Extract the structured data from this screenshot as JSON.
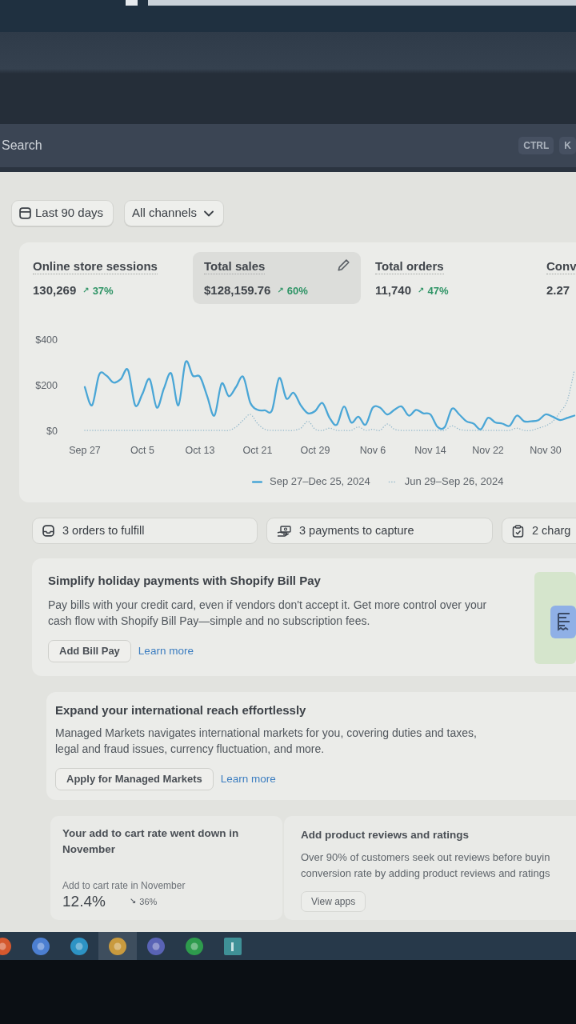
{
  "browser": {
    "search": {
      "placeholder": "Search",
      "shortcut_keys": [
        "CTRL",
        "K"
      ]
    }
  },
  "filters": [
    {
      "kind": "date",
      "label": "Last 90 days"
    },
    {
      "kind": "dropdown",
      "label": "All channels"
    }
  ],
  "metrics": [
    {
      "label": "Online store sessions",
      "value": "130,269",
      "arrow": "↗",
      "change": "37%",
      "selected": false
    },
    {
      "label": "Total sales",
      "value": "$128,159.76",
      "arrow": "↗",
      "change": "60%",
      "selected": true
    },
    {
      "label": "Total orders",
      "value": "11,740",
      "arrow": "↗",
      "change": "47%",
      "selected": false
    },
    {
      "label": "Conv",
      "value": "2.27",
      "selected": false
    }
  ],
  "chart_data": {
    "type": "line",
    "legend": "bottom",
    "categories": [
      "Sep 27",
      null,
      null,
      null,
      null,
      null,
      null,
      null,
      "Oct 5",
      null,
      null,
      null,
      null,
      null,
      null,
      null,
      "Oct 13",
      null,
      null,
      null,
      null,
      null,
      null,
      null,
      "Oct 21",
      null,
      null,
      null,
      null,
      null,
      null,
      null,
      "Oct 29",
      null,
      null,
      null,
      null,
      null,
      null,
      null,
      "Nov 6",
      null,
      null,
      null,
      null,
      null,
      null,
      null,
      "Nov 14",
      null,
      null,
      null,
      null,
      null,
      null,
      null,
      "Nov 22",
      null,
      null,
      null,
      null,
      null,
      null,
      null,
      "Nov 30",
      null,
      null,
      null,
      null
    ],
    "ylim": [
      0,
      400
    ],
    "yticks": [
      {
        "value": 0,
        "label": "$0"
      },
      {
        "value": 200,
        "label": "$200"
      },
      {
        "value": 400,
        "label": "$400"
      }
    ],
    "series": [
      {
        "name": "Sep 27–Dec 25, 2024",
        "color": "#4aa6d6",
        "line_style": "solid",
        "values": [
          190,
          110,
          245,
          240,
          210,
          225,
          265,
          110,
          160,
          225,
          100,
          185,
          250,
          110,
          300,
          240,
          235,
          150,
          65,
          205,
          150,
          190,
          235,
          120,
          90,
          88,
          88,
          230,
          140,
          165,
          110,
          75,
          85,
          120,
          55,
          25,
          105,
          35,
          60,
          25,
          100,
          100,
          70,
          90,
          105,
          65,
          90,
          75,
          70,
          15,
          15,
          95,
          70,
          40,
          30,
          5,
          55,
          35,
          30,
          20,
          65,
          40,
          40,
          45,
          70,
          60,
          45,
          55,
          65
        ]
      },
      {
        "name": "Jun 29–Sep 26, 2024",
        "color": "#93b8cb",
        "line_style": "dotted",
        "values": [
          0,
          0,
          0,
          0,
          0,
          0,
          0,
          0,
          0,
          0,
          0,
          0,
          0,
          0,
          0,
          0,
          0,
          0,
          0,
          0,
          0,
          15,
          45,
          70,
          30,
          5,
          0,
          0,
          0,
          0,
          10,
          40,
          5,
          0,
          10,
          0,
          0,
          0,
          15,
          0,
          5,
          0,
          28,
          5,
          0,
          0,
          0,
          0,
          0,
          0,
          0,
          20,
          5,
          0,
          0,
          0,
          0,
          0,
          0,
          0,
          10,
          0,
          0,
          10,
          20,
          40,
          80,
          130,
          265
        ]
      }
    ]
  },
  "tasks": [
    {
      "kind": "orders",
      "label": "3 orders to fulfill"
    },
    {
      "kind": "payments",
      "label": "3 payments to capture"
    },
    {
      "kind": "charges",
      "label": "2 charg"
    }
  ],
  "promos": [
    {
      "kind": "illustrated",
      "title": "Simplify holiday payments with Shopify Bill Pay",
      "body": "Pay bills with your credit card, even if vendors don't accept it. Get more control over your cash flow with Shopify Bill Pay—simple and no subscription fees.",
      "button": "Add Bill Pay",
      "link": "Learn more"
    },
    {
      "kind": "plain",
      "title": "Expand your international reach effortlessly",
      "body": "Managed Markets navigates international markets for you, covering duties and taxes, legal and fraud issues, currency fluctuation, and more.",
      "button": "Apply for Managed Markets",
      "link": "Learn more"
    }
  ],
  "insights": [
    {
      "kind": "metric",
      "title": "Your add to cart rate went down in November",
      "metric_label": "Add to cart rate in November",
      "value": "12.4%",
      "arrow": "↘",
      "change": "36%"
    },
    {
      "kind": "app",
      "title": "Add product reviews and ratings",
      "body_lines": [
        "Over 90% of customers seek out reviews before buyin",
        "conversion rate by adding product reviews and ratings"
      ],
      "button": "View apps"
    }
  ],
  "taskbar": {
    "apps": [
      {
        "kind": "round",
        "color": "#d4582e",
        "selected": false
      },
      {
        "kind": "round",
        "color": "#4c7fd1",
        "selected": false
      },
      {
        "kind": "round",
        "color": "#2d93c4",
        "selected": false
      },
      {
        "kind": "round",
        "color": "#c99a3e",
        "selected": true
      },
      {
        "kind": "round",
        "color": "#5963b5",
        "selected": false
      },
      {
        "kind": "round",
        "color": "#2e9b4d",
        "selected": false
      },
      {
        "kind": "tile",
        "color": "#3f9197",
        "selected": false
      }
    ]
  }
}
